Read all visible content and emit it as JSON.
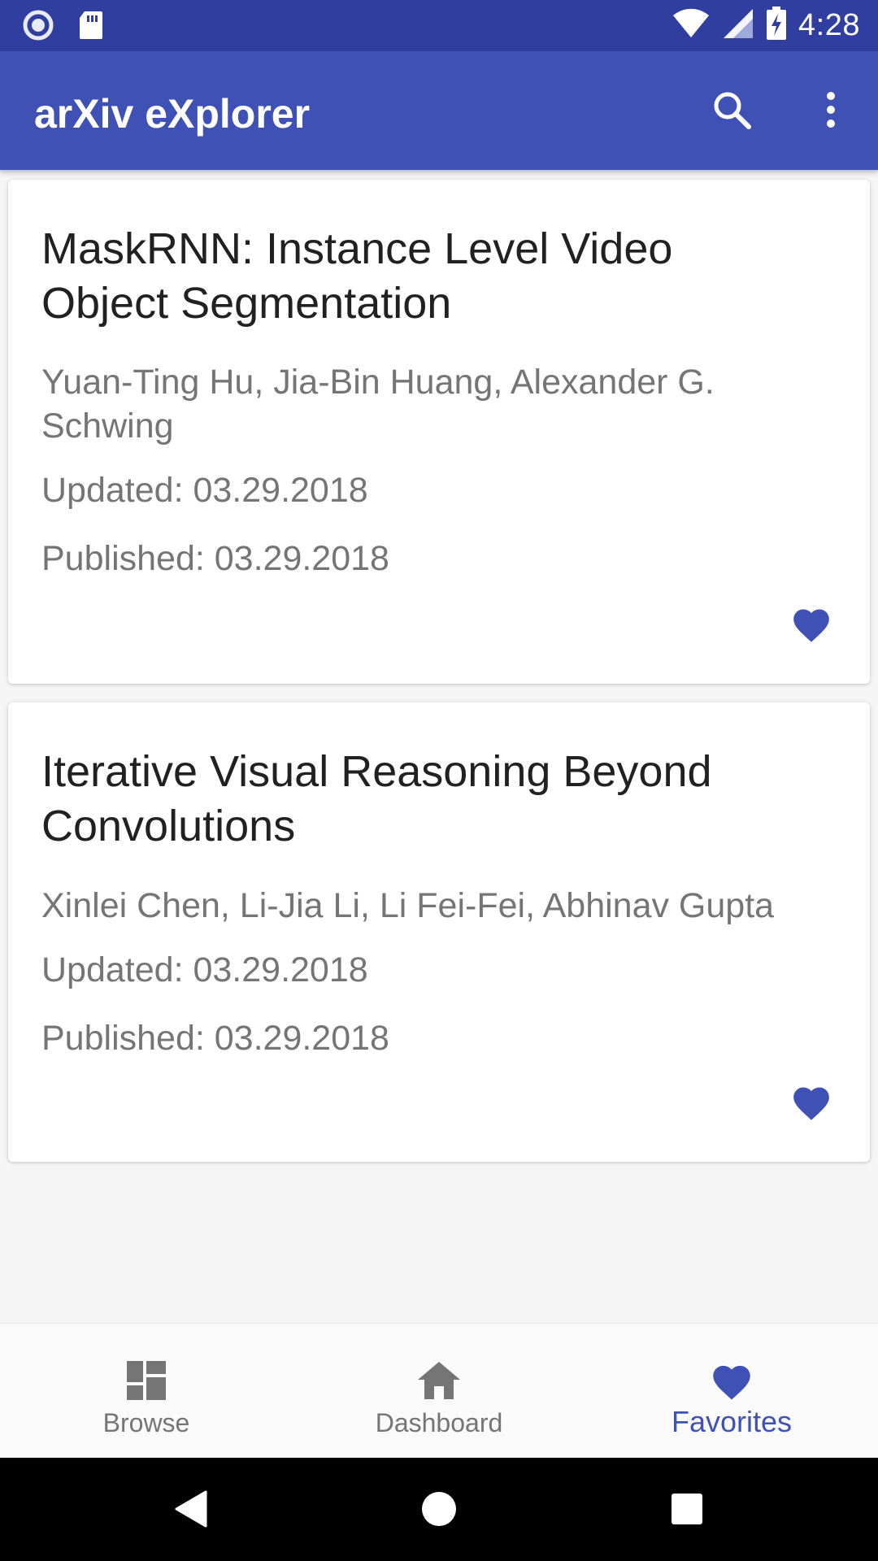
{
  "status_bar": {
    "time": "4:28",
    "left_icons": [
      "record-icon",
      "sd-card-icon"
    ],
    "right_icons": [
      "wifi-icon",
      "cell-signal-icon",
      "battery-charging-icon"
    ]
  },
  "app_bar": {
    "title": "arXiv eXplorer",
    "actions": [
      "search-icon",
      "more-vert-icon"
    ]
  },
  "papers": [
    {
      "title": "MaskRNN: Instance Level Video Object Segmentation",
      "authors": "Yuan-Ting Hu, Jia-Bin Huang, Alexander G. Schwing",
      "updated": "Updated: 03.29.2018",
      "published": "Published: 03.29.2018",
      "favorite_icon": "heart-icon"
    },
    {
      "title": "Iterative Visual Reasoning Beyond Convolutions",
      "authors": "Xinlei Chen, Li-Jia Li, Li Fei-Fei, Abhinav Gupta",
      "updated": "Updated: 03.29.2018",
      "published": "Published: 03.29.2018",
      "favorite_icon": "heart-icon"
    }
  ],
  "bottom_nav": {
    "items": [
      {
        "label": "Browse",
        "icon": "dashboard-grid-icon",
        "active": false
      },
      {
        "label": "Dashboard",
        "icon": "home-icon",
        "active": false
      },
      {
        "label": "Favorites",
        "icon": "heart-icon",
        "active": true
      }
    ]
  },
  "system_nav": [
    "back-icon",
    "home-circle-icon",
    "recents-icon"
  ],
  "colors": {
    "primary": "#3f51b5",
    "primary_dark": "#303f9f",
    "title_text": "#212121",
    "secondary_text": "#757575",
    "inactive_icon": "#757575"
  }
}
